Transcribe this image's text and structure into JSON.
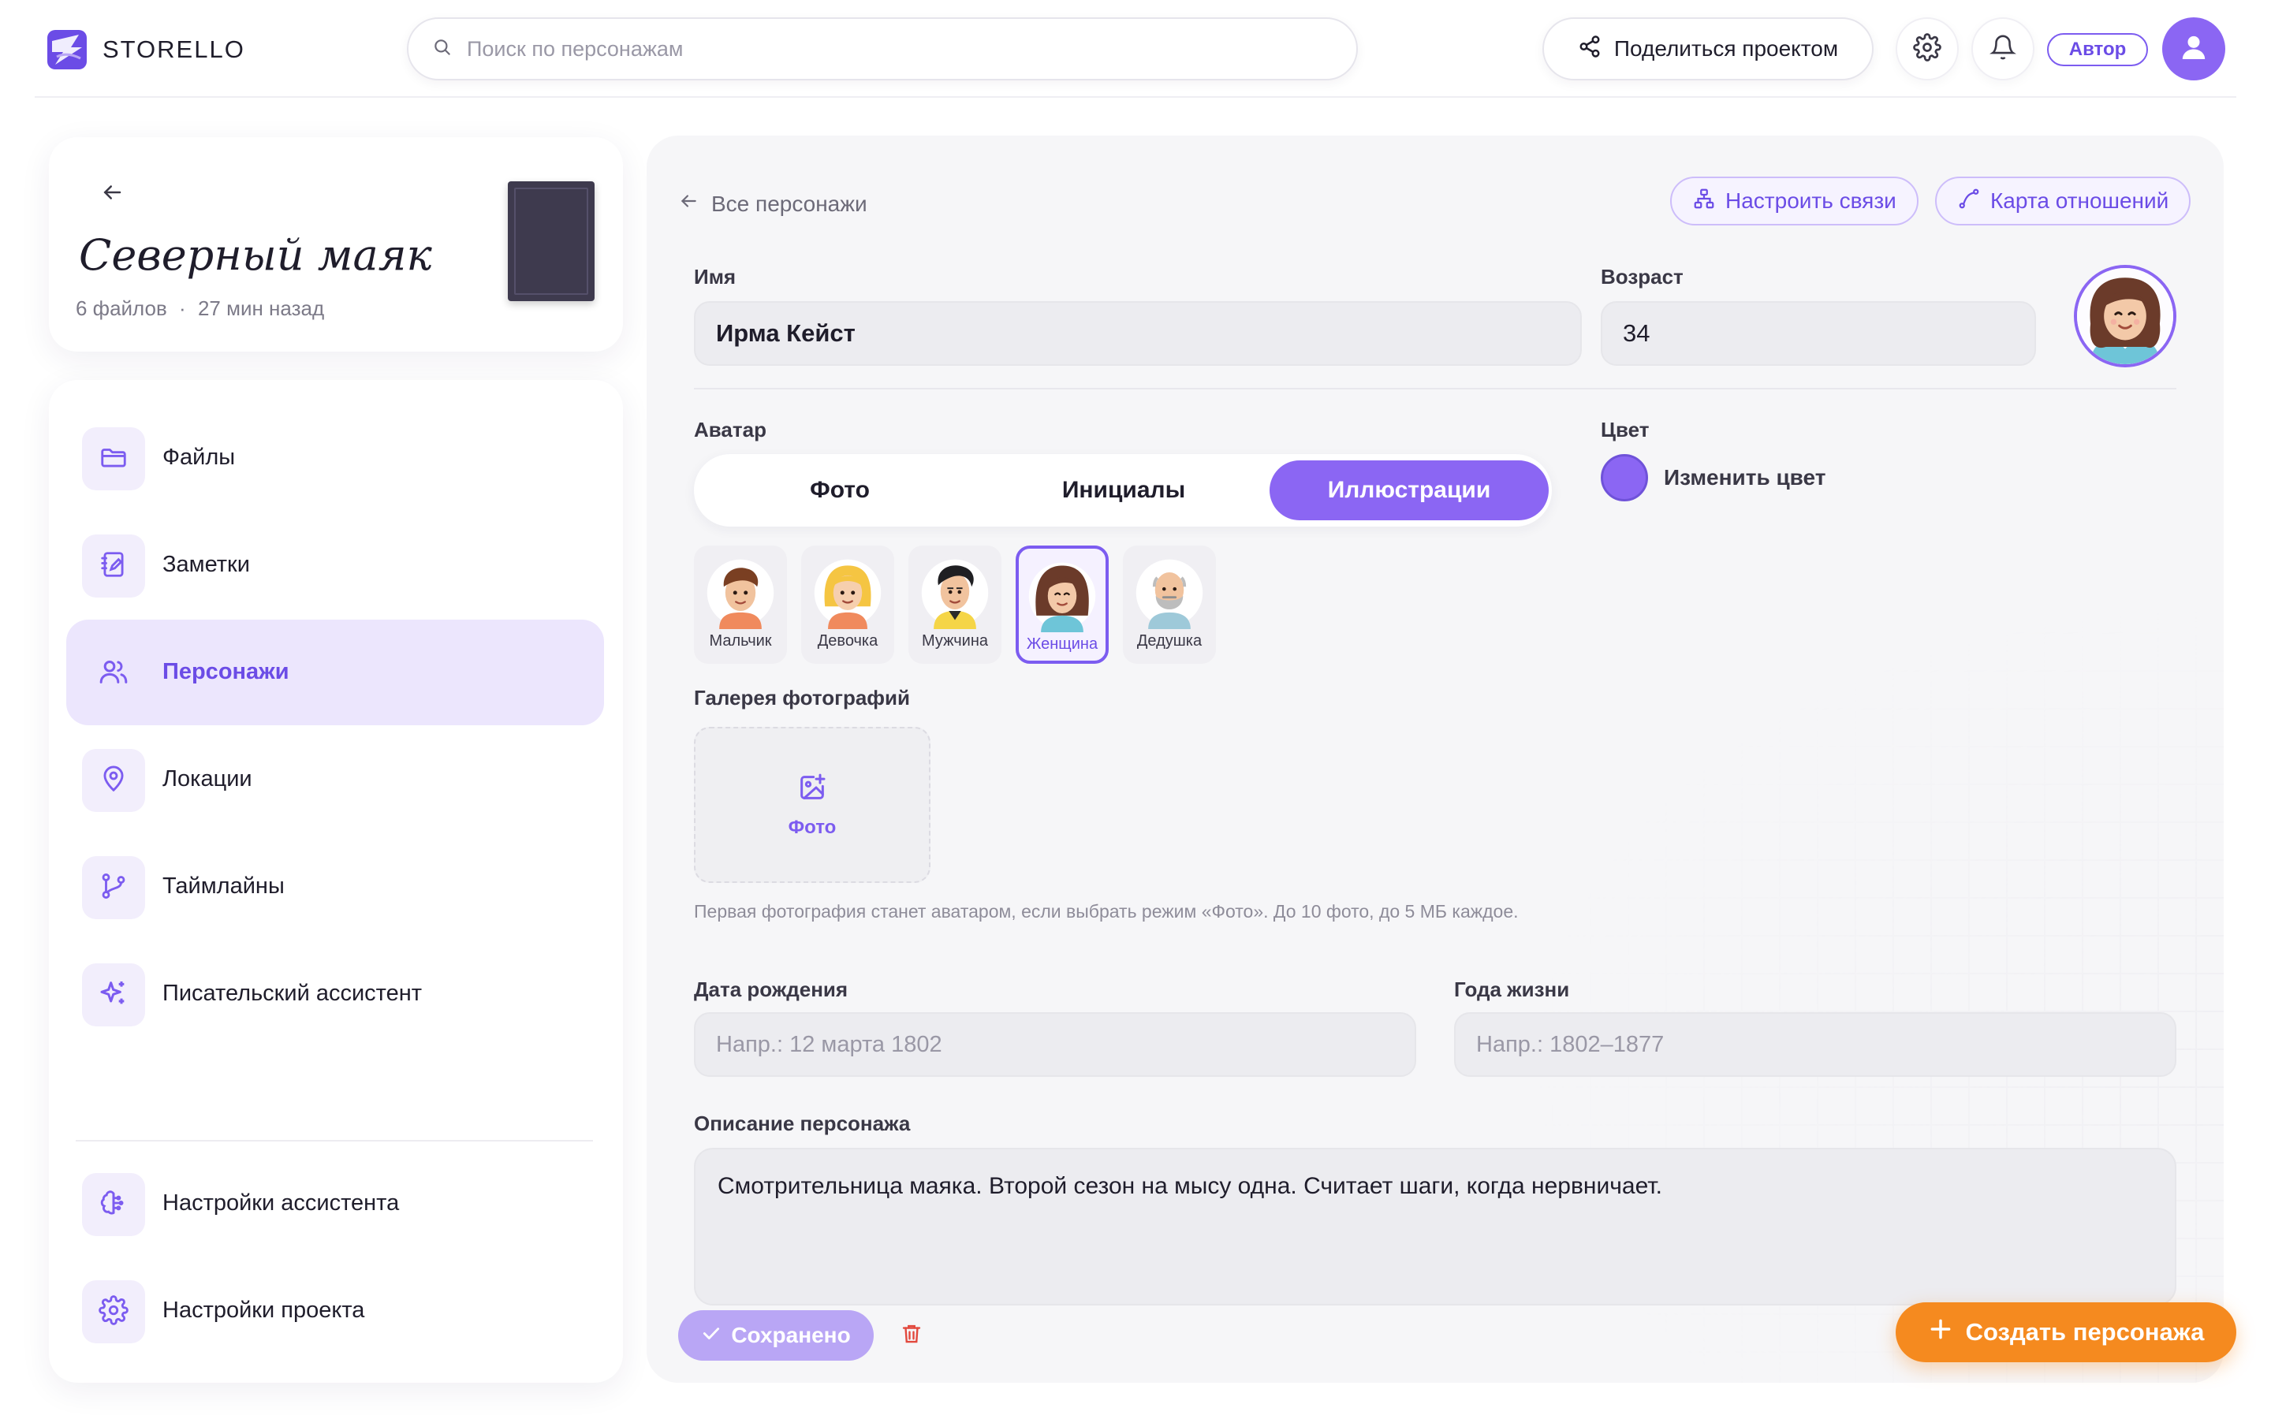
{
  "app": {
    "name": "STORELLO"
  },
  "header": {
    "search_placeholder": "Поиск по персонажам",
    "share_label": "Поделиться проектом",
    "role_badge": "Автор"
  },
  "project": {
    "title": "Северный маяк",
    "files": "6 файлов",
    "separator": "·",
    "updated": "27 мин назад"
  },
  "nav": {
    "items": [
      {
        "label": "Файлы",
        "icon": "folder-icon"
      },
      {
        "label": "Заметки",
        "icon": "notes-icon"
      },
      {
        "label": "Персонажи",
        "icon": "users-icon",
        "active": true
      },
      {
        "label": "Локации",
        "icon": "location-pin-icon"
      },
      {
        "label": "Таймлайны",
        "icon": "timeline-branch-icon"
      },
      {
        "label": "Писательский ассистент",
        "icon": "sparkles-icon"
      }
    ],
    "bottom": [
      {
        "label": "Настройки ассистента",
        "icon": "brain-icon"
      },
      {
        "label": "Настройки проекта",
        "icon": "gear-icon"
      }
    ]
  },
  "editor": {
    "breadcrumb": "Все персонажи",
    "relations_btn": "Настроить связи",
    "map_btn": "Карта отношений",
    "name_label": "Имя",
    "name_value": "Ирма Кейст",
    "age_label": "Возраст",
    "age_value": "34",
    "avatar_label": "Аватар",
    "avatar_modes": [
      "Фото",
      "Инициалы",
      "Иллюстрации"
    ],
    "avatar_mode_selected": "Иллюстрации",
    "color_label": "Цвет",
    "color_change": "Изменить цвет",
    "color_value": "#8b66f3",
    "illustrations": [
      "Мальчик",
      "Девочка",
      "Мужчина",
      "Женщина",
      "Дедушка"
    ],
    "illustration_selected": "Женщина",
    "gallery_label": "Галерея фотографий",
    "gallery_add": "Фото",
    "gallery_hint": "Первая фотография станет аватаром, если выбрать режим «Фото». До 10 фото, до 5 МБ каждое.",
    "birth_label": "Дата рождения",
    "birth_placeholder": "Напр.: 12 марта 1802",
    "years_label": "Года жизни",
    "years_placeholder": "Напр.: 1802–1877",
    "desc_label": "Описание персонажа",
    "desc_value": "Смотрительница маяка. Второй сезон на мысу одна. Считает шаги, когда нервничает.",
    "saved_label": "Сохранено",
    "create_label": "Создать персонажа"
  },
  "colors": {
    "accent": "#8b66f3",
    "accent_dark": "#6b4ce6",
    "orange": "#f58a1f"
  }
}
